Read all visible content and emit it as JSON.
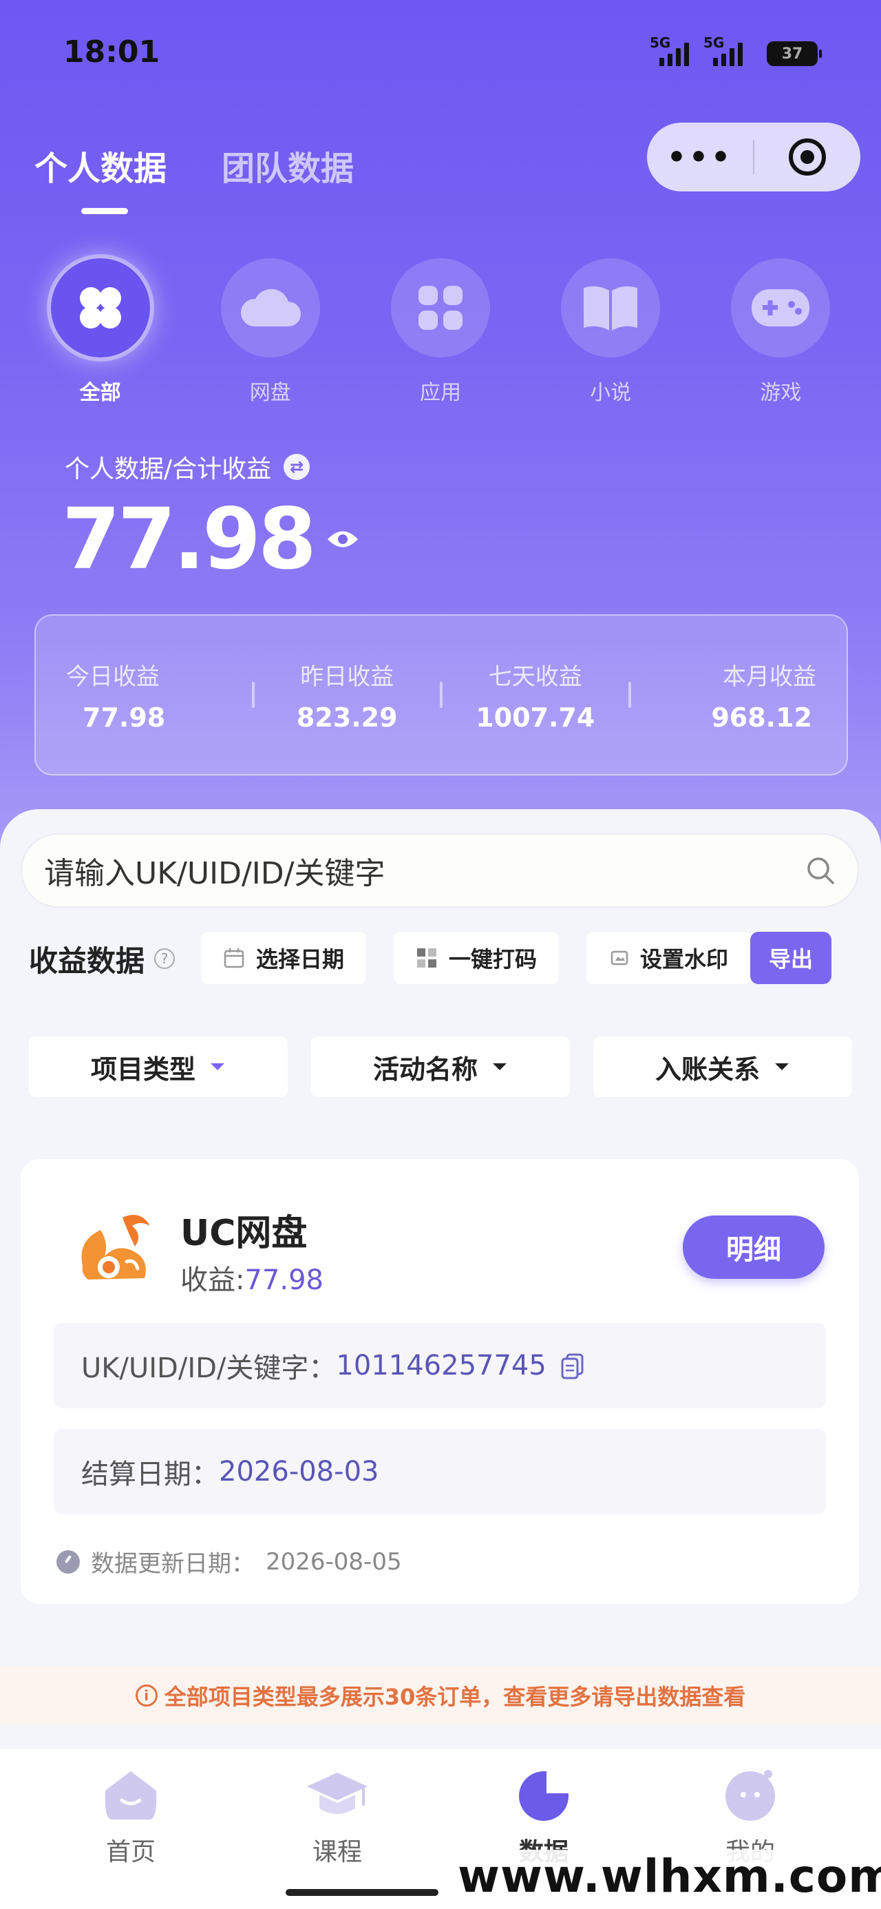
{
  "status_bar": {
    "time": "18:01",
    "signal1": "5G",
    "signal2": "5G",
    "battery": "37"
  },
  "header": {
    "tabs": [
      "个人数据",
      "团队数据"
    ],
    "active_tab": 0,
    "capsule_more": "•••"
  },
  "categories": [
    {
      "label": "全部",
      "icon": "clover-icon",
      "active": true
    },
    {
      "label": "网盘",
      "icon": "cloud-icon",
      "active": false
    },
    {
      "label": "应用",
      "icon": "apps-icon",
      "active": false
    },
    {
      "label": "小说",
      "icon": "book-icon",
      "active": false
    },
    {
      "label": "游戏",
      "icon": "gamepad-icon",
      "active": false
    }
  ],
  "summary": {
    "label": "个人数据/合计收益",
    "total": "77.98"
  },
  "stats": [
    {
      "label": "今日收益",
      "value": "77.98"
    },
    {
      "label": "昨日收益",
      "value": "823.29"
    },
    {
      "label": "七天收益",
      "value": "1007.74"
    },
    {
      "label": "本月收益",
      "value": "968.12"
    }
  ],
  "search": {
    "placeholder": "请输入UK/UID/ID/关键字"
  },
  "toolbar": {
    "title": "收益数据",
    "help": "?",
    "date_btn": "选择日期",
    "mask_btn": "一键打码",
    "watermark_btn": "设置水印",
    "export_btn": "导出"
  },
  "filters": [
    "项目类型",
    "活动名称",
    "入账关系"
  ],
  "card": {
    "name": "UC网盘",
    "earn_label": "收益:",
    "earn_value": "77.98",
    "detail_btn": "明细",
    "key_label": "UK/UID/ID/关键字：",
    "key_value": "101146257745",
    "settle_label": "结算日期：",
    "settle_value": "2026-08-03",
    "update_label": "数据更新日期：",
    "update_value": "2026-08-05"
  },
  "notice": {
    "icon": "i",
    "text": "全部项目类型最多展示30条订单，查看更多请导出数据查看"
  },
  "nav": [
    {
      "label": "首页",
      "icon": "home-icon"
    },
    {
      "label": "课程",
      "icon": "graduation-cap-icon"
    },
    {
      "label": "数据",
      "icon": "pie-chart-icon"
    },
    {
      "label": "我的",
      "icon": "profile-icon"
    }
  ],
  "watermark": "www.wlhxm.com",
  "colors": {
    "accent": "#7966ee",
    "gradient_top": "#6d58f2",
    "notice": "#e27240"
  }
}
